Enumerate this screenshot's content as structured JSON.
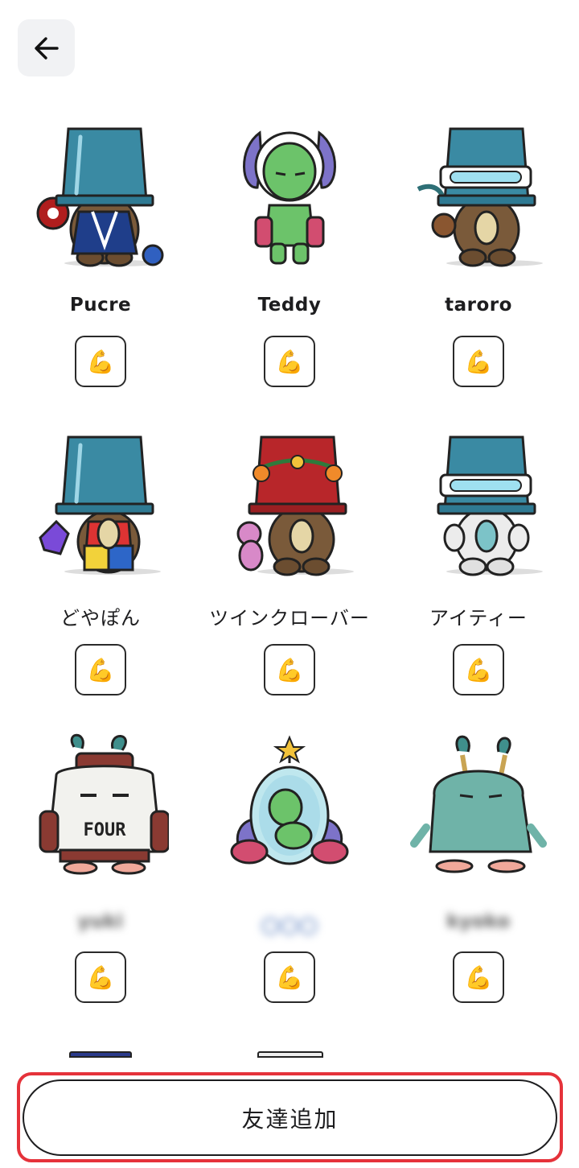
{
  "header": {
    "back_icon": "arrow-left-icon"
  },
  "friends": [
    {
      "name": "Pucre",
      "avatar": "bucket-bear-kimono",
      "reaction_icon": "flexed-biceps-icon"
    },
    {
      "name": "Teddy",
      "avatar": "green-alien",
      "reaction_icon": "flexed-biceps-icon"
    },
    {
      "name": "taroro",
      "avatar": "bucket-goggles-plant",
      "reaction_icon": "flexed-biceps-icon"
    },
    {
      "name": "どやぽん",
      "avatar": "bucket-colorful-body",
      "reaction_icon": "flexed-biceps-icon"
    },
    {
      "name": "ツインクローバー",
      "avatar": "red-bucket-flowers-teddy",
      "reaction_icon": "flexed-biceps-icon"
    },
    {
      "name": "アイティー",
      "avatar": "bucket-goggles-white",
      "reaction_icon": "flexed-biceps-icon"
    },
    {
      "name": "yuki",
      "avatar": "sweater-monster",
      "reaction_icon": "flexed-biceps-icon",
      "blurred": true
    },
    {
      "name": "〇〇〇",
      "avatar": "alien-in-capsule",
      "reaction_icon": "flexed-biceps-icon",
      "blurred": true
    },
    {
      "name": "kyoko",
      "avatar": "furry-green-monster",
      "reaction_icon": "flexed-biceps-icon",
      "blurred": true
    }
  ],
  "footer": {
    "add_friend_label": "友達追加"
  },
  "colors": {
    "bucket_teal": "#3a8aa3",
    "bucket_red": "#b8262a",
    "bear_brown": "#7a5a3a",
    "highlight_red": "#e5323a"
  }
}
